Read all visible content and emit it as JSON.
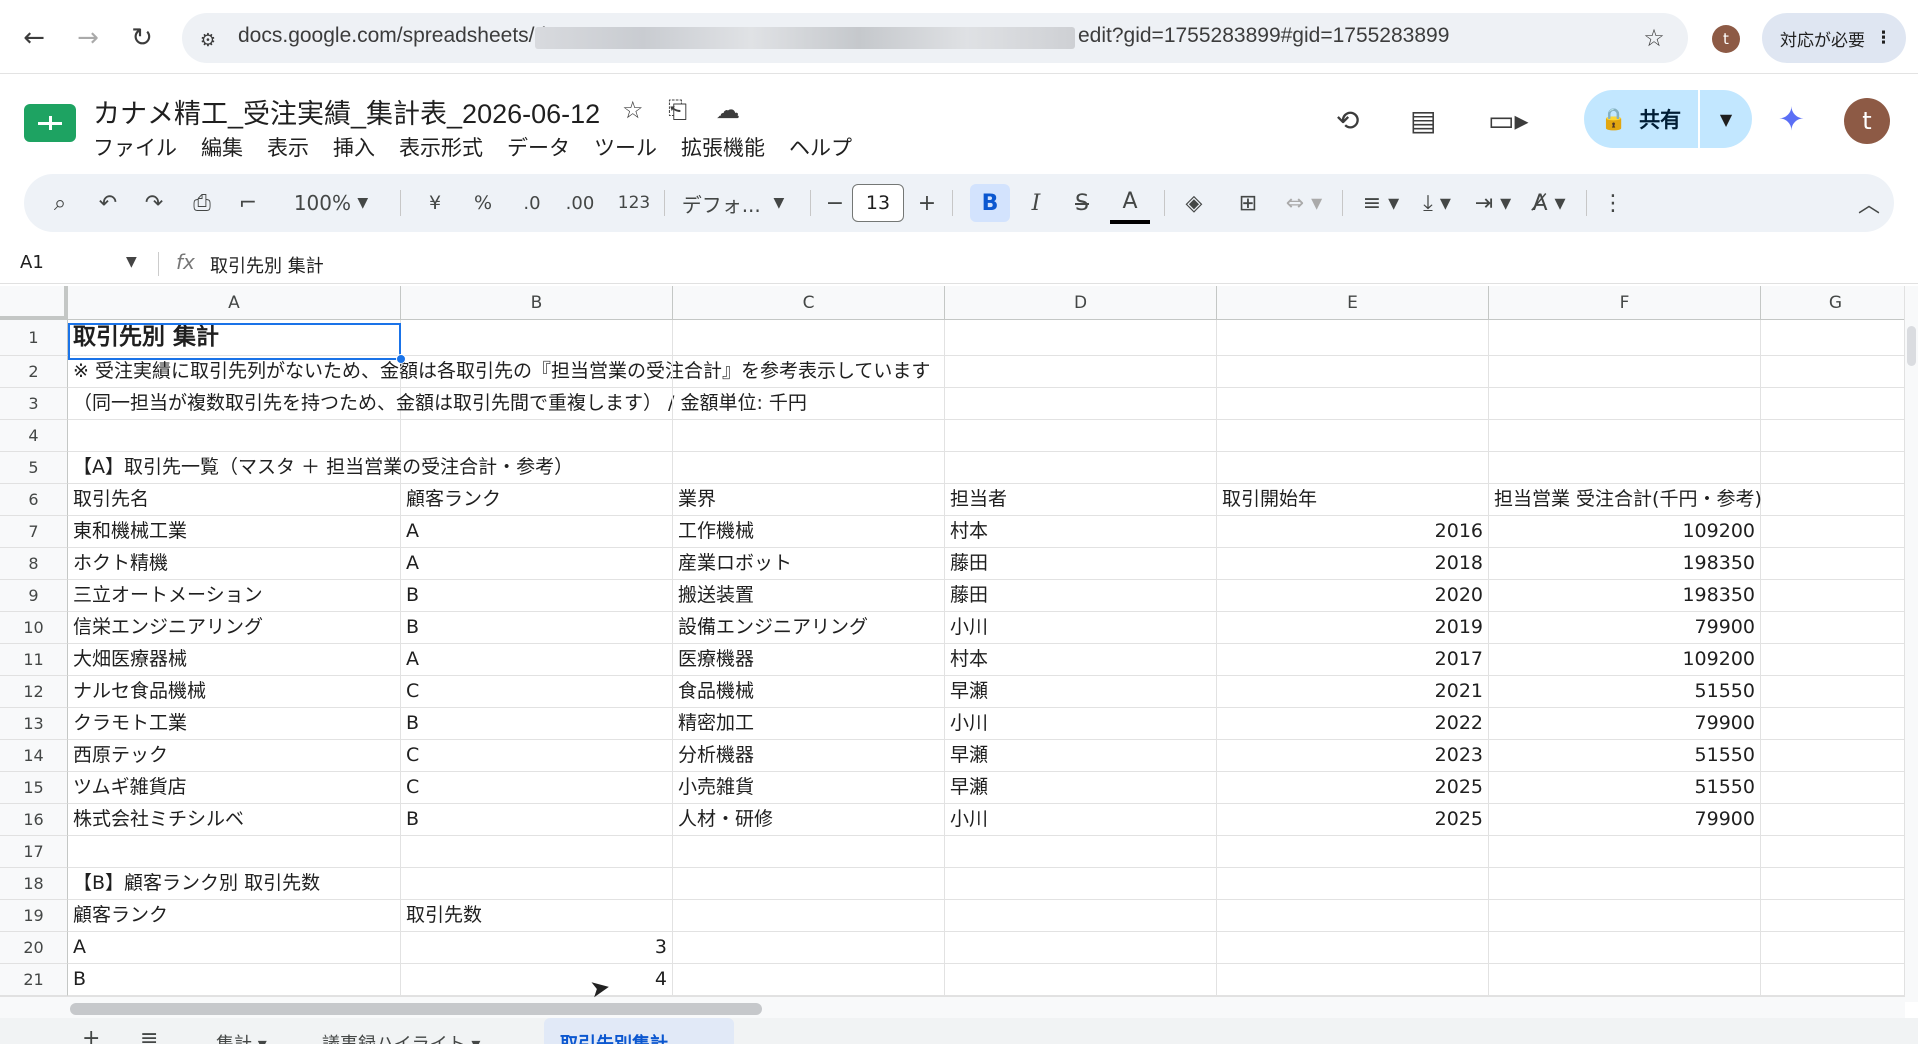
{
  "browser": {
    "url_prefix": "docs.google.com/spreadsheets/d",
    "url_suffix": "edit?gid=1755283899#gid=1755283899",
    "profile_initial": "t",
    "chip_label": "対応が必要"
  },
  "doc": {
    "title": "カナメ精工_受注実績_集計表_2026-06-12",
    "menu": [
      "ファイル",
      "編集",
      "表示",
      "挿入",
      "表示形式",
      "データ",
      "ツール",
      "拡張機能",
      "ヘルプ"
    ],
    "share_label": "共有",
    "avatar_initial": "t"
  },
  "toolbar": {
    "zoom": "100%",
    "currency": "¥",
    "percent": "%",
    "dec_decrease": ".0",
    "dec_increase": ".00",
    "number_format": "123",
    "font": "デフォ...",
    "font_size": "13",
    "bold": "B",
    "italic": "I",
    "strike": "S",
    "text_color": "A"
  },
  "formula_bar": {
    "cell_ref": "A1",
    "fx": "fx",
    "content": "取引先別 集計"
  },
  "columns": [
    "A",
    "B",
    "C",
    "D",
    "E",
    "F",
    "G"
  ],
  "rows": [
    {
      "n": "1",
      "A": "取引先別 集計"
    },
    {
      "n": "2",
      "A": "※ 受注実績に取引先列がないため、金額は各取引先の『担当営業の受注合計』を参考表示しています"
    },
    {
      "n": "3",
      "A": "（同一担当が複数取引先を持つため、金額は取引先間で重複します） / 金額単位: 千円"
    },
    {
      "n": "4"
    },
    {
      "n": "5",
      "A": "【A】取引先一覧（マスタ ＋ 担当営業の受注合計・参考）"
    },
    {
      "n": "6",
      "A": "取引先名",
      "B": "顧客ランク",
      "C": "業界",
      "D": "担当者",
      "E": "取引開始年",
      "F": "担当営業 受注合計(千円・参考)"
    },
    {
      "n": "7",
      "A": "東和機械工業",
      "B": "A",
      "C": "工作機械",
      "D": "村本",
      "E": "2016",
      "F": "109200"
    },
    {
      "n": "8",
      "A": "ホクト精機",
      "B": "A",
      "C": "産業ロボット",
      "D": "藤田",
      "E": "2018",
      "F": "198350"
    },
    {
      "n": "9",
      "A": "三立オートメーション",
      "B": "B",
      "C": "搬送装置",
      "D": "藤田",
      "E": "2020",
      "F": "198350"
    },
    {
      "n": "10",
      "A": "信栄エンジニアリング",
      "B": "B",
      "C": "設備エンジニアリング",
      "D": "小川",
      "E": "2019",
      "F": "79900"
    },
    {
      "n": "11",
      "A": "大畑医療器械",
      "B": "A",
      "C": "医療機器",
      "D": "村本",
      "E": "2017",
      "F": "109200"
    },
    {
      "n": "12",
      "A": "ナルセ食品機械",
      "B": "C",
      "C": "食品機械",
      "D": "早瀬",
      "E": "2021",
      "F": "51550"
    },
    {
      "n": "13",
      "A": "クラモト工業",
      "B": "B",
      "C": "精密加工",
      "D": "小川",
      "E": "2022",
      "F": "79900"
    },
    {
      "n": "14",
      "A": "西原テック",
      "B": "C",
      "C": "分析機器",
      "D": "早瀬",
      "E": "2023",
      "F": "51550"
    },
    {
      "n": "15",
      "A": "ツムギ雑貨店",
      "B": "C",
      "C": "小売雑貨",
      "D": "早瀬",
      "E": "2025",
      "F": "51550"
    },
    {
      "n": "16",
      "A": "株式会社ミチシルベ",
      "B": "B",
      "C": "人材・研修",
      "D": "小川",
      "E": "2025",
      "F": "79900"
    },
    {
      "n": "17"
    },
    {
      "n": "18",
      "A": "【B】顧客ランク別 取引先数"
    },
    {
      "n": "19",
      "A": "顧客ランク",
      "B": "取引先数"
    },
    {
      "n": "20",
      "A": "A",
      "Bnum": "3"
    },
    {
      "n": "21",
      "A": "B",
      "Bnum": "4"
    }
  ],
  "sheet_tabs": {
    "tab1": "集計",
    "tab2": "議事録ハイライト",
    "active": "取引先別集計"
  }
}
